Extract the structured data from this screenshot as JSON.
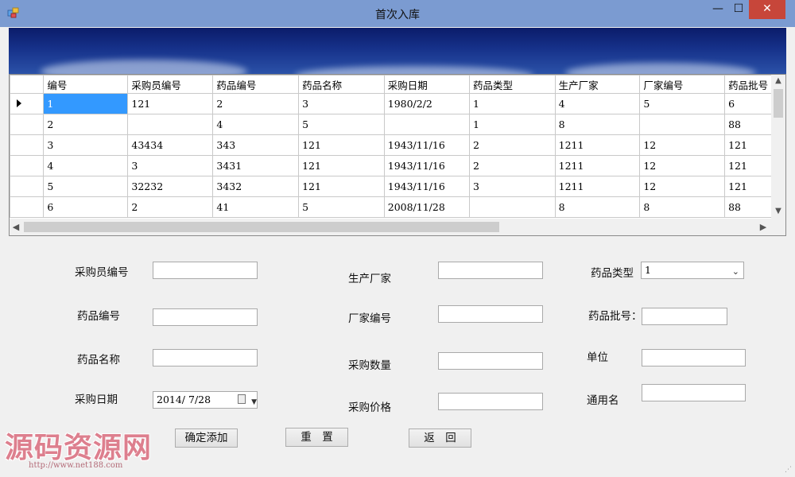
{
  "window": {
    "title": "首次入库",
    "controls": {
      "minimize": "—",
      "maximize": "☐",
      "close": "✕"
    }
  },
  "grid": {
    "columns": [
      "编号",
      "采购员编号",
      "药品编号",
      "药品名称",
      "采购日期",
      "药品类型",
      "生产厂家",
      "厂家编号",
      "药品批号"
    ],
    "rows": [
      [
        "1",
        "121",
        "2",
        "3",
        "1980/2/2",
        "1",
        "4",
        "5",
        "6"
      ],
      [
        "2",
        "",
        "4",
        "5",
        "",
        "1",
        "8",
        "",
        "88"
      ],
      [
        "3",
        "43434",
        "343",
        "121",
        "1943/11/16",
        "2",
        "1211",
        "12",
        "121"
      ],
      [
        "4",
        "3",
        "3431",
        "121",
        "1943/11/16",
        "2",
        "1211",
        "12",
        "121"
      ],
      [
        "5",
        "32232",
        "3432",
        "121",
        "1943/11/16",
        "3",
        "1211",
        "12",
        "121"
      ],
      [
        "6",
        "2",
        "41",
        "5",
        "2008/11/28",
        "",
        "8",
        "8",
        "88"
      ]
    ],
    "selected_row": 0
  },
  "form": {
    "buyer_id_label": "采购员编号",
    "drug_id_label": "药品编号",
    "drug_name_label": "药品名称",
    "purchase_date_label": "采购日期",
    "manufacturer_label": "生产厂家",
    "vendor_id_label": "厂家编号",
    "quantity_label": "采购数量",
    "price_label": "采购价格",
    "drug_type_label": "药品类型",
    "batch_no_label": "药品批号：",
    "unit_label": "单位",
    "generic_name_label": "通用名",
    "drug_type_value": "1",
    "purchase_date_value": "2014/ 7/28"
  },
  "buttons": {
    "confirm_add": "确定添加",
    "reset": "重　置",
    "back": "返　回"
  },
  "watermark": {
    "text": "源码资源网",
    "url": "http://www.net188.com"
  },
  "colors": {
    "titlebar": "#7b9bd1",
    "close_button": "#c7463a",
    "selection": "#3399ff",
    "watermark": "#dd7f8e"
  }
}
